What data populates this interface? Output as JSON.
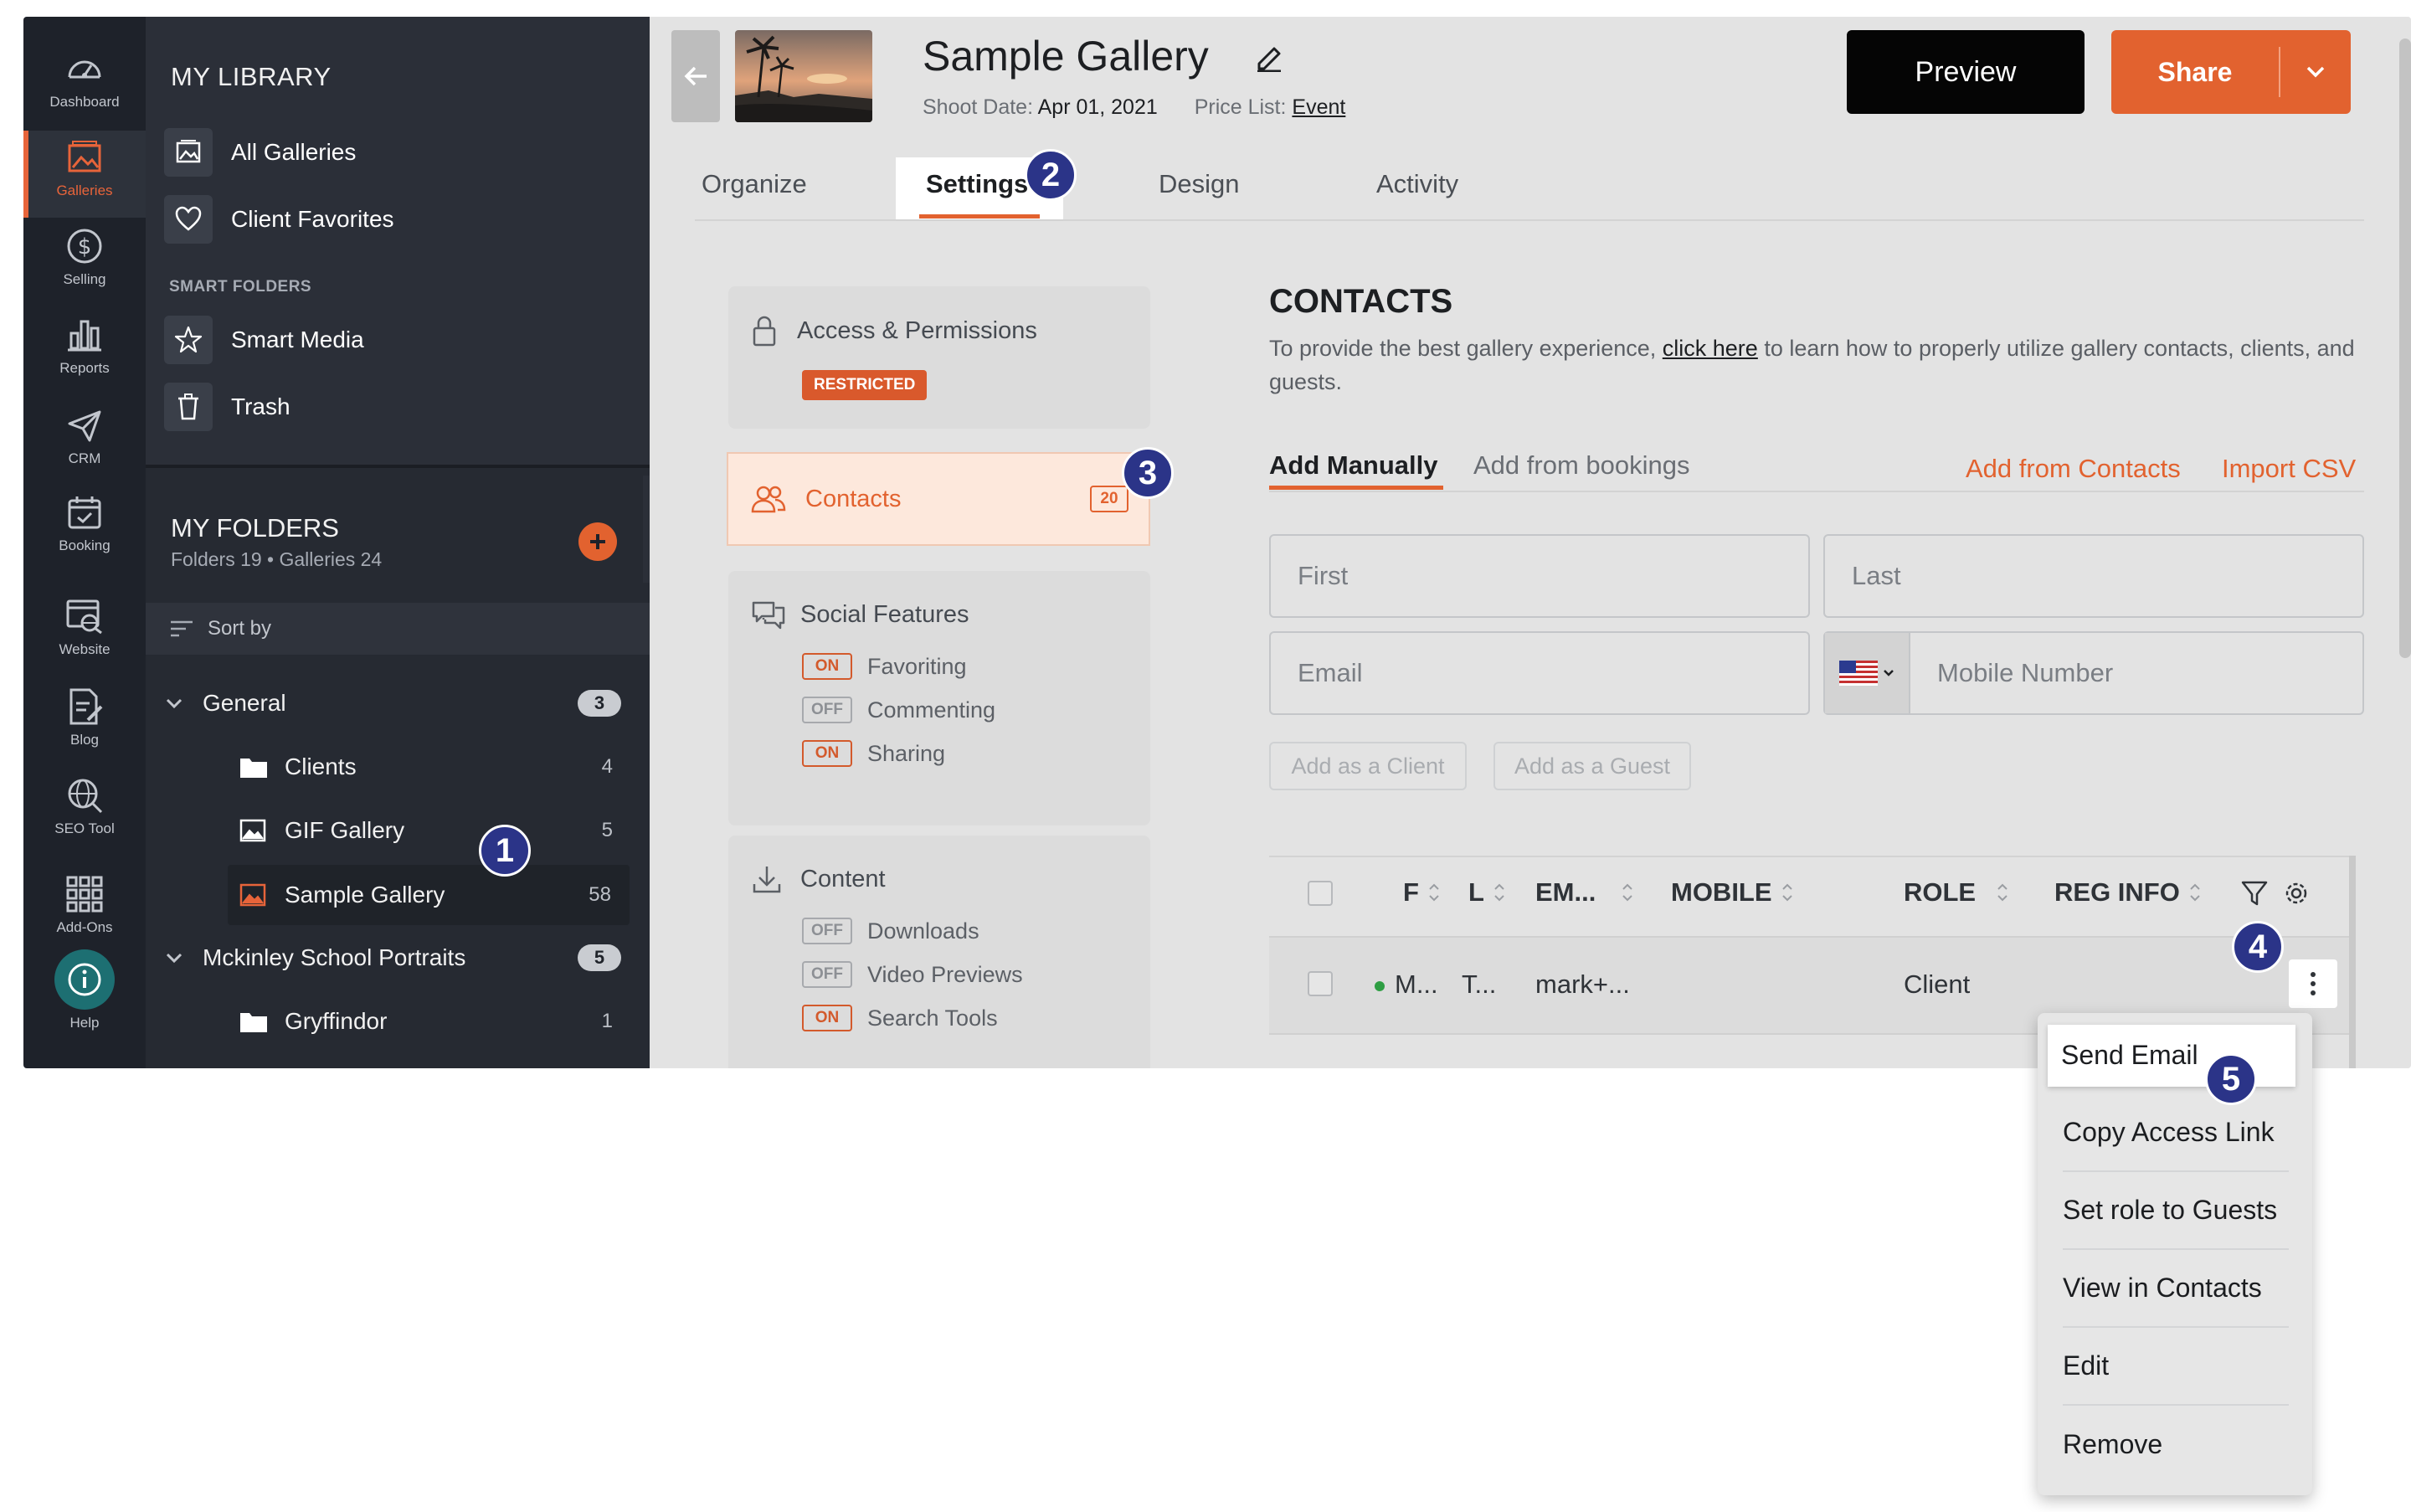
{
  "colors": {
    "accent": "#e2622f",
    "rail_bg": "#1e222a",
    "panel_bg": "#2b2f38",
    "step_badge": "#2b3488",
    "status_dot": "#2e9e43"
  },
  "rail": {
    "items": [
      {
        "label": "Dashboard",
        "icon": "dashboard-gauge-icon"
      },
      {
        "label": "Galleries",
        "icon": "galleries-image-icon"
      },
      {
        "label": "Selling",
        "icon": "dollar-icon"
      },
      {
        "label": "Reports",
        "icon": "bar-chart-icon"
      },
      {
        "label": "CRM",
        "icon": "paper-plane-icon"
      },
      {
        "label": "Booking",
        "icon": "calendar-icon"
      },
      {
        "label": "Website",
        "icon": "website-icon"
      },
      {
        "label": "Blog",
        "icon": "blog-icon"
      },
      {
        "label": "SEO Tool",
        "icon": "seo-globe-icon"
      },
      {
        "label": "Add-Ons",
        "icon": "grid-icon"
      },
      {
        "label": "Help",
        "icon": "info-icon"
      }
    ]
  },
  "library": {
    "title": "MY LIBRARY",
    "items": [
      {
        "label": "All Galleries"
      },
      {
        "label": "Client Favorites"
      }
    ],
    "smart_title": "SMART FOLDERS",
    "smart_items": [
      {
        "label": "Smart Media"
      },
      {
        "label": "Trash"
      }
    ],
    "folders_title": "MY FOLDERS",
    "folders_meta": "Folders 19 • Galleries 24",
    "sort_label": "Sort by",
    "tree": [
      {
        "label": "General",
        "count": "3"
      },
      {
        "label": "Clients",
        "count": "4"
      },
      {
        "label": "GIF Gallery",
        "count": "5"
      },
      {
        "label": "Sample Gallery",
        "count": "58"
      },
      {
        "label": "Mckinley School Portraits",
        "count": "5"
      },
      {
        "label": "Gryffindor",
        "count": "1"
      }
    ]
  },
  "header": {
    "title": "Sample Gallery",
    "shoot_date_label": "Shoot Date:",
    "shoot_date": "Apr 01, 2021",
    "price_list_label": "Price List:",
    "price_list": "Event",
    "preview": "Preview",
    "share": "Share"
  },
  "tabs": [
    {
      "label": "Organize"
    },
    {
      "label": "Settings"
    },
    {
      "label": "Design"
    },
    {
      "label": "Activity"
    }
  ],
  "settings_nav": {
    "access": {
      "label": "Access & Permissions",
      "badge": "RESTRICTED"
    },
    "contacts": {
      "label": "Contacts",
      "count": "20"
    },
    "social": {
      "label": "Social Features",
      "flags": [
        {
          "state": "ON",
          "label": "Favoriting"
        },
        {
          "state": "OFF",
          "label": "Commenting"
        },
        {
          "state": "ON",
          "label": "Sharing"
        }
      ]
    },
    "content": {
      "label": "Content",
      "flags": [
        {
          "state": "OFF",
          "label": "Downloads"
        },
        {
          "state": "OFF",
          "label": "Video Previews"
        },
        {
          "state": "ON",
          "label": "Search Tools"
        }
      ]
    }
  },
  "contacts": {
    "title": "CONTACTS",
    "desc_before": "To provide the best gallery experience, ",
    "desc_link": "click here",
    "desc_after": " to learn how to properly utilize gallery contacts, clients, and guests.",
    "tab_manual": "Add Manually",
    "tab_bookings": "Add from bookings",
    "add_from_contacts": "Add from Contacts",
    "import_csv": "Import CSV",
    "first_placeholder": "First",
    "last_placeholder": "Last",
    "email_placeholder": "Email",
    "mobile_placeholder": "Mobile Number",
    "add_client": "Add as a Client",
    "add_guest": "Add as a Guest",
    "columns": {
      "first": "F",
      "last": "L",
      "email": "EM...",
      "mobile": "MOBILE",
      "role": "ROLE",
      "reg": "REG INFO"
    },
    "row": {
      "first": "M...",
      "last": "T...",
      "email": "mark+...",
      "role": "Client"
    }
  },
  "menu": {
    "items": [
      {
        "label": "Send Email"
      },
      {
        "label": "Copy Access Link"
      },
      {
        "label": "Set role to Guests"
      },
      {
        "label": "View in Contacts"
      },
      {
        "label": "Edit"
      },
      {
        "label": "Remove"
      }
    ]
  },
  "steps": [
    "1",
    "2",
    "3",
    "4",
    "5"
  ]
}
